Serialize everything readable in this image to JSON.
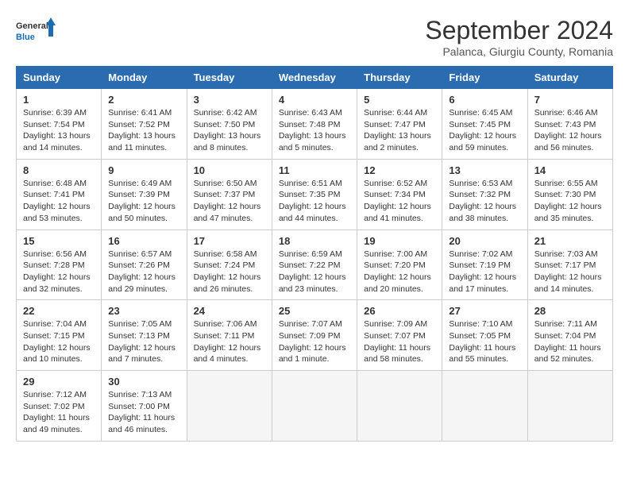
{
  "header": {
    "logo_line1": "General",
    "logo_line2": "Blue",
    "month": "September 2024",
    "location": "Palanca, Giurgiu County, Romania"
  },
  "weekdays": [
    "Sunday",
    "Monday",
    "Tuesday",
    "Wednesday",
    "Thursday",
    "Friday",
    "Saturday"
  ],
  "weeks": [
    [
      {
        "day": "1",
        "info": "Sunrise: 6:39 AM\nSunset: 7:54 PM\nDaylight: 13 hours and 14 minutes."
      },
      {
        "day": "2",
        "info": "Sunrise: 6:41 AM\nSunset: 7:52 PM\nDaylight: 13 hours and 11 minutes."
      },
      {
        "day": "3",
        "info": "Sunrise: 6:42 AM\nSunset: 7:50 PM\nDaylight: 13 hours and 8 minutes."
      },
      {
        "day": "4",
        "info": "Sunrise: 6:43 AM\nSunset: 7:48 PM\nDaylight: 13 hours and 5 minutes."
      },
      {
        "day": "5",
        "info": "Sunrise: 6:44 AM\nSunset: 7:47 PM\nDaylight: 13 hours and 2 minutes."
      },
      {
        "day": "6",
        "info": "Sunrise: 6:45 AM\nSunset: 7:45 PM\nDaylight: 12 hours and 59 minutes."
      },
      {
        "day": "7",
        "info": "Sunrise: 6:46 AM\nSunset: 7:43 PM\nDaylight: 12 hours and 56 minutes."
      }
    ],
    [
      {
        "day": "8",
        "info": "Sunrise: 6:48 AM\nSunset: 7:41 PM\nDaylight: 12 hours and 53 minutes."
      },
      {
        "day": "9",
        "info": "Sunrise: 6:49 AM\nSunset: 7:39 PM\nDaylight: 12 hours and 50 minutes."
      },
      {
        "day": "10",
        "info": "Sunrise: 6:50 AM\nSunset: 7:37 PM\nDaylight: 12 hours and 47 minutes."
      },
      {
        "day": "11",
        "info": "Sunrise: 6:51 AM\nSunset: 7:35 PM\nDaylight: 12 hours and 44 minutes."
      },
      {
        "day": "12",
        "info": "Sunrise: 6:52 AM\nSunset: 7:34 PM\nDaylight: 12 hours and 41 minutes."
      },
      {
        "day": "13",
        "info": "Sunrise: 6:53 AM\nSunset: 7:32 PM\nDaylight: 12 hours and 38 minutes."
      },
      {
        "day": "14",
        "info": "Sunrise: 6:55 AM\nSunset: 7:30 PM\nDaylight: 12 hours and 35 minutes."
      }
    ],
    [
      {
        "day": "15",
        "info": "Sunrise: 6:56 AM\nSunset: 7:28 PM\nDaylight: 12 hours and 32 minutes."
      },
      {
        "day": "16",
        "info": "Sunrise: 6:57 AM\nSunset: 7:26 PM\nDaylight: 12 hours and 29 minutes."
      },
      {
        "day": "17",
        "info": "Sunrise: 6:58 AM\nSunset: 7:24 PM\nDaylight: 12 hours and 26 minutes."
      },
      {
        "day": "18",
        "info": "Sunrise: 6:59 AM\nSunset: 7:22 PM\nDaylight: 12 hours and 23 minutes."
      },
      {
        "day": "19",
        "info": "Sunrise: 7:00 AM\nSunset: 7:20 PM\nDaylight: 12 hours and 20 minutes."
      },
      {
        "day": "20",
        "info": "Sunrise: 7:02 AM\nSunset: 7:19 PM\nDaylight: 12 hours and 17 minutes."
      },
      {
        "day": "21",
        "info": "Sunrise: 7:03 AM\nSunset: 7:17 PM\nDaylight: 12 hours and 14 minutes."
      }
    ],
    [
      {
        "day": "22",
        "info": "Sunrise: 7:04 AM\nSunset: 7:15 PM\nDaylight: 12 hours and 10 minutes."
      },
      {
        "day": "23",
        "info": "Sunrise: 7:05 AM\nSunset: 7:13 PM\nDaylight: 12 hours and 7 minutes."
      },
      {
        "day": "24",
        "info": "Sunrise: 7:06 AM\nSunset: 7:11 PM\nDaylight: 12 hours and 4 minutes."
      },
      {
        "day": "25",
        "info": "Sunrise: 7:07 AM\nSunset: 7:09 PM\nDaylight: 12 hours and 1 minute."
      },
      {
        "day": "26",
        "info": "Sunrise: 7:09 AM\nSunset: 7:07 PM\nDaylight: 11 hours and 58 minutes."
      },
      {
        "day": "27",
        "info": "Sunrise: 7:10 AM\nSunset: 7:05 PM\nDaylight: 11 hours and 55 minutes."
      },
      {
        "day": "28",
        "info": "Sunrise: 7:11 AM\nSunset: 7:04 PM\nDaylight: 11 hours and 52 minutes."
      }
    ],
    [
      {
        "day": "29",
        "info": "Sunrise: 7:12 AM\nSunset: 7:02 PM\nDaylight: 11 hours and 49 minutes."
      },
      {
        "day": "30",
        "info": "Sunrise: 7:13 AM\nSunset: 7:00 PM\nDaylight: 11 hours and 46 minutes."
      },
      {
        "day": "",
        "info": ""
      },
      {
        "day": "",
        "info": ""
      },
      {
        "day": "",
        "info": ""
      },
      {
        "day": "",
        "info": ""
      },
      {
        "day": "",
        "info": ""
      }
    ]
  ]
}
